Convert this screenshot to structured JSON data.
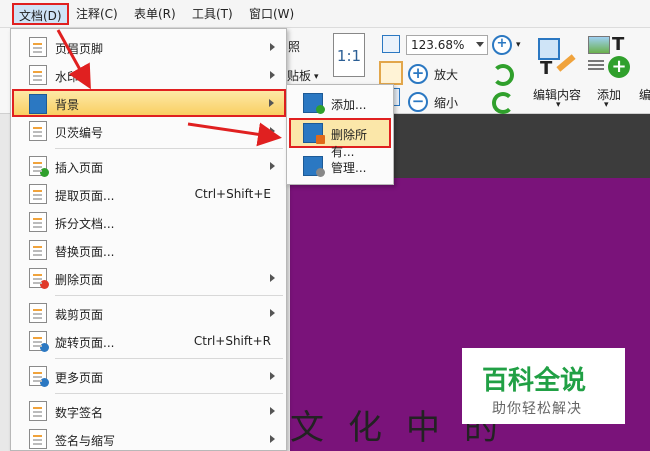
{
  "menubar": {
    "items": [
      "文档(D)",
      "注释(C)",
      "表单(R)",
      "工具(T)",
      "窗口(W)"
    ]
  },
  "ribbon": {
    "zoom_value": "123.68%",
    "zoom_in_label": "放大",
    "zoom_out_label": "缩小",
    "partial_label_1": "照",
    "partial_label_2": "贴板",
    "edit_content_label": "编辑内容",
    "add_label": "添加",
    "partial_label_3": "编",
    "one_to_one": "1:1"
  },
  "menu": {
    "items": [
      {
        "label": "页眉页脚",
        "shortcut": "",
        "submenu": true
      },
      {
        "label": "水印",
        "shortcut": "",
        "submenu": true
      },
      {
        "label": "背景",
        "shortcut": "",
        "submenu": true
      },
      {
        "label": "贝茨编号",
        "shortcut": "",
        "submenu": true
      },
      {
        "label": "插入页面",
        "shortcut": "",
        "submenu": true
      },
      {
        "label": "提取页面...",
        "shortcut": "Ctrl+Shift+E",
        "submenu": false
      },
      {
        "label": "拆分文档...",
        "shortcut": "",
        "submenu": false
      },
      {
        "label": "替换页面...",
        "shortcut": "",
        "submenu": false
      },
      {
        "label": "删除页面",
        "shortcut": "",
        "submenu": true
      },
      {
        "label": "裁剪页面",
        "shortcut": "",
        "submenu": true
      },
      {
        "label": "旋转页面...",
        "shortcut": "Ctrl+Shift+R",
        "submenu": false
      },
      {
        "label": "更多页面",
        "shortcut": "",
        "submenu": true
      },
      {
        "label": "数字签名",
        "shortcut": "",
        "submenu": true
      },
      {
        "label": "签名与缩写",
        "shortcut": "",
        "submenu": true
      }
    ]
  },
  "submenu": {
    "items": [
      {
        "label": "添加..."
      },
      {
        "label": "删除所有..."
      },
      {
        "label": "管理..."
      }
    ]
  },
  "document": {
    "calligraphy": "文化中的"
  },
  "watermark": {
    "title": "百科全说",
    "subtitle": "助你轻松解决"
  },
  "colors": {
    "highlight_border": "#e02020",
    "menu_highlight": "#f9cf63",
    "page_purple": "#7a137a",
    "watermark_green": "#21a045"
  }
}
